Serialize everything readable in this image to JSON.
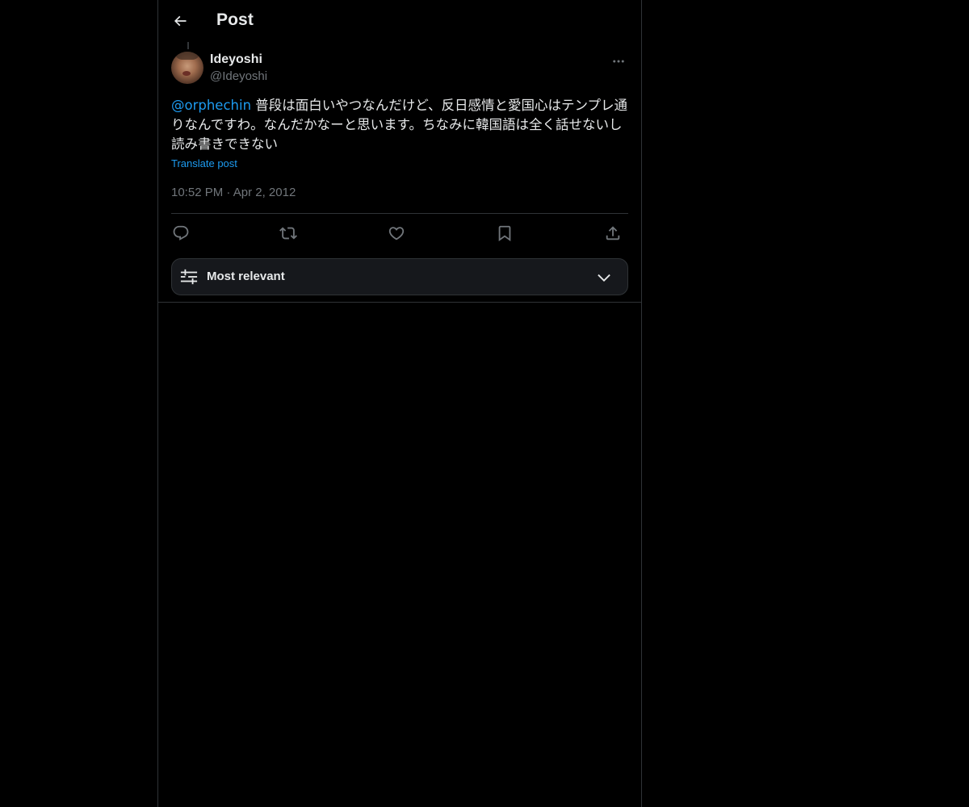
{
  "header": {
    "title": "Post",
    "back_icon": "arrow-left-icon"
  },
  "post": {
    "author": {
      "display_name": "Ideyoshi",
      "handle": "@Ideyoshi",
      "avatar_icon": "avatar-photo"
    },
    "mention": "@orphechin",
    "text": " 普段は面白いやつなんだけど、反日感情と愛国心はテンプレ通りなんですわ。なんだかなーと思います。ちなみに韓国語は全く話せないし読み書きできない",
    "translate_label": "Translate post",
    "time": "10:52 PM",
    "separator": "·",
    "date": "Apr 2, 2012"
  },
  "actions": {
    "reply_icon": "reply-icon",
    "repost_icon": "repost-icon",
    "like_icon": "heart-icon",
    "bookmark_icon": "bookmark-icon",
    "share_icon": "share-icon"
  },
  "sort": {
    "label": "Most relevant",
    "icon": "sliders-icon",
    "chevron": "chevron-down-icon"
  },
  "colors": {
    "background": "#000000",
    "text": "#e7e9ea",
    "muted": "#71767b",
    "accent": "#1d9bf0",
    "border": "#2f3336"
  }
}
